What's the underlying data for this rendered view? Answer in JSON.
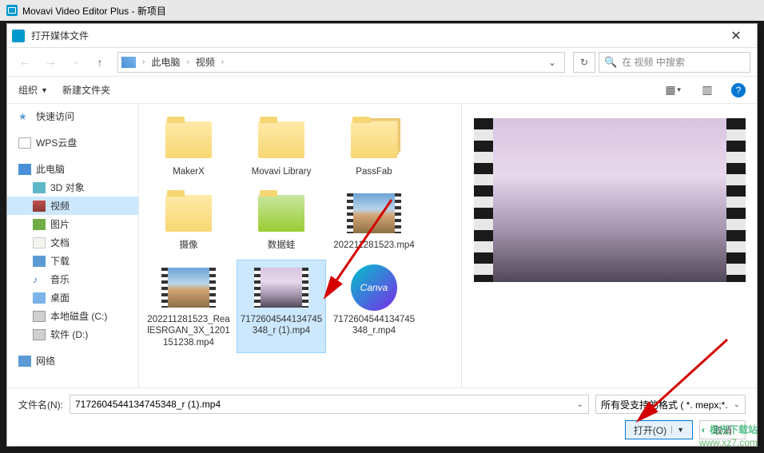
{
  "app": {
    "title": "Movavi Video Editor Plus - 新项目"
  },
  "dialog": {
    "title": "打开媒体文件"
  },
  "breadcrumb": {
    "root": "此电脑",
    "seg2": "视频"
  },
  "search": {
    "placeholder": "在 视频 中搜索"
  },
  "toolbar": {
    "organize": "组织",
    "newfolder": "新建文件夹"
  },
  "tree": {
    "quick": "快速访问",
    "wps": "WPS云盘",
    "pc": "此电脑",
    "d3": "3D 对象",
    "video": "视频",
    "pic": "图片",
    "doc": "文档",
    "dl": "下载",
    "music": "音乐",
    "desk": "桌面",
    "cdrive": "本地磁盘 (C:)",
    "ddrive": "软件 (D:)",
    "net": "网络"
  },
  "files": {
    "f1": "MakerX",
    "f2": "Movavi Library",
    "f3": "PassFab",
    "f4": "摄像",
    "f5": "数据蛙",
    "f6": "202211281523.mp4",
    "f7": "202211281523_RealESRGAN_3X_1201151238.mp4",
    "f8": "7172604544134745348_r (1).mp4",
    "f9": "7172604544134745348_r.mp4"
  },
  "canva": "Canva",
  "bottom": {
    "fn_label": "文件名(N):",
    "fn_value": "7172604544134745348_r (1).mp4",
    "filter": "所有受支持的格式 ( *. mepx;*.",
    "open": "打开(O)",
    "cancel": "取消"
  },
  "watermark": {
    "name": "极光下载站",
    "url": "www.xz7.com"
  }
}
